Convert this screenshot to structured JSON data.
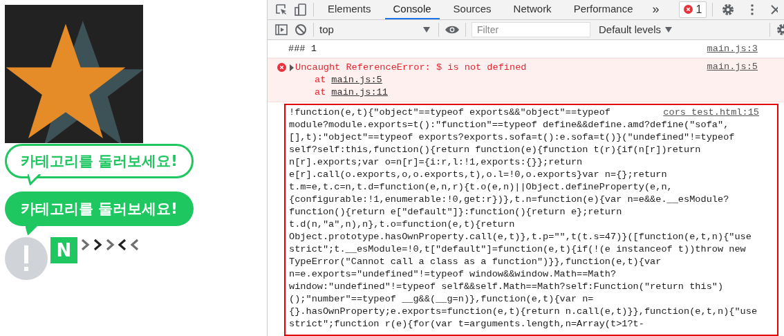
{
  "page": {
    "bubbles": [
      {
        "text": "카테고리를 둘러보세요!",
        "kind": "outline"
      },
      {
        "text": "카테고리를 둘러보세요!",
        "kind": "filled"
      }
    ],
    "badge_letter": "N",
    "chevrons": [
      {
        "kind": "right",
        "color": "#6e6e6e"
      },
      {
        "kind": "right",
        "color": "#222222"
      },
      {
        "kind": "right",
        "color": "#6e6e6e"
      },
      {
        "kind": "left",
        "color": "#222222"
      },
      {
        "kind": "left",
        "color": "#6e6e6e"
      }
    ]
  },
  "devtools": {
    "tabs": [
      {
        "label": "Elements",
        "selected": false
      },
      {
        "label": "Console",
        "selected": true
      },
      {
        "label": "Sources",
        "selected": false
      },
      {
        "label": "Network",
        "selected": false
      },
      {
        "label": "Performance",
        "selected": false
      }
    ],
    "overflow_label": "»",
    "error_count": "1",
    "context": "top",
    "filter": {
      "placeholder": "Filter"
    },
    "levels": "Default levels",
    "messages": [
      {
        "kind": "log",
        "text": "### 1",
        "source": "main.js:3"
      },
      {
        "kind": "error",
        "text": "Uncaught ReferenceError: $ is not defined",
        "source": "main.js:5",
        "stack": [
          {
            "prefix": "at",
            "link": "main.js:5"
          },
          {
            "prefix": "at",
            "link": "main.js:11"
          }
        ]
      },
      {
        "kind": "code",
        "source": "cors_test.html:15",
        "highlighted": true,
        "lines": [
          "!function(e,t){\"object\"==typeof exports&&\"object\"==typeof",
          "module?module.exports=t():\"function\"==typeof define&&define.amd?define(\"sofa\",",
          "[],t):\"object\"==typeof exports?exports.sofa=t():e.sofa=t()}(\"undefined\"!=typeof",
          "self?self:this,function(){return function(e){function t(r){if(n[r])return",
          "n[r].exports;var o=n[r]={i:r,l:!1,exports:{}};return",
          "e[r].call(o.exports,o,o.exports,t),o.l=!0,o.exports}var n={};return",
          "t.m=e,t.c=n,t.d=function(e,n,r){t.o(e,n)||Object.defineProperty(e,n,",
          "{configurable:!1,enumerable:!0,get:r})},t.n=function(e){var n=e&&e.__esModule?",
          "function(){return e[\"default\"]}:function(){return e};return",
          "t.d(n,\"a\",n),n},t.o=function(e,t){return",
          "Object.prototype.hasOwnProperty.call(e,t)},t.p=\"\",t(t.s=47)}([function(e,t,n){\"use",
          "strict\";t.__esModule=!0,t[\"default\"]=function(e,t){if(!(e instanceof t))throw new",
          "TypeError(\"Cannot call a class as a function\")}},function(e,t){var",
          "n=e.exports=\"undefined\"!=typeof window&&window.Math==Math?",
          "window:\"undefined\"!=typeof self&&self.Math==Math?self:Function(\"return this\")",
          "();\"number\"==typeof __g&&(__g=n)},function(e,t){var n=",
          "{}.hasOwnProperty;e.exports=function(e,t){return n.call(e,t)}},function(e,t,n){\"use",
          "strict\";function r(e){for(var t=arguments.length,n=Array(t>1?t-"
        ]
      }
    ]
  }
}
